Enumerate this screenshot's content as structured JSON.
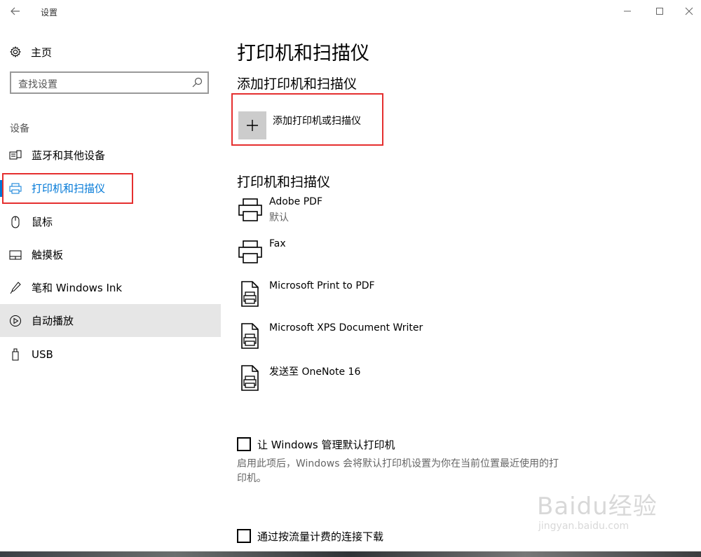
{
  "window": {
    "title": "设置",
    "controls": {
      "minimize": "minimize-icon",
      "maximize": "maximize-icon",
      "close": "close-icon"
    }
  },
  "nav": {
    "home_label": "主页",
    "search_placeholder": "查找设置",
    "section_title": "设备",
    "items": [
      {
        "label": "蓝牙和其他设备",
        "icon": "bluetooth-device-icon",
        "active": false
      },
      {
        "label": "打印机和扫描仪",
        "icon": "printer-icon",
        "active": true
      },
      {
        "label": "鼠标",
        "icon": "mouse-icon",
        "active": false
      },
      {
        "label": "触摸板",
        "icon": "touchpad-icon",
        "active": false
      },
      {
        "label": "笔和 Windows Ink",
        "icon": "pen-icon",
        "active": false
      },
      {
        "label": "自动播放",
        "icon": "autoplay-icon",
        "active": false,
        "hover": true
      },
      {
        "label": "USB",
        "icon": "usb-icon",
        "active": false
      }
    ]
  },
  "content": {
    "page_title": "打印机和扫描仪",
    "add_section_title": "添加打印机和扫描仪",
    "add_button_label": "添加打印机或扫描仪",
    "list_section_title": "打印机和扫描仪",
    "printers": [
      {
        "name": "Adobe PDF",
        "status": "默认",
        "icon": "printer-icon"
      },
      {
        "name": "Fax",
        "status": "",
        "icon": "printer-icon"
      },
      {
        "name": "Microsoft Print to PDF",
        "status": "",
        "icon": "document-printer-icon"
      },
      {
        "name": "Microsoft XPS Document Writer",
        "status": "",
        "icon": "document-printer-icon"
      },
      {
        "name": "发送至 OneNote 16",
        "status": "",
        "icon": "document-printer-icon"
      }
    ],
    "manage_default": {
      "label": "让 Windows 管理默认打印机",
      "checked": false,
      "description": "启用此项后，Windows 会将默认打印机设置为你在当前位置最近使用的打印机。"
    },
    "metered_download": {
      "label": "通过按流量计费的连接下载",
      "checked": false
    }
  },
  "watermark": {
    "brand": "Baidu经验",
    "url": "jingyan.baidu.com"
  },
  "colors": {
    "accent": "#0078d7",
    "highlight_box": "#e52f2f",
    "hover_bg": "#e6e6e6"
  }
}
